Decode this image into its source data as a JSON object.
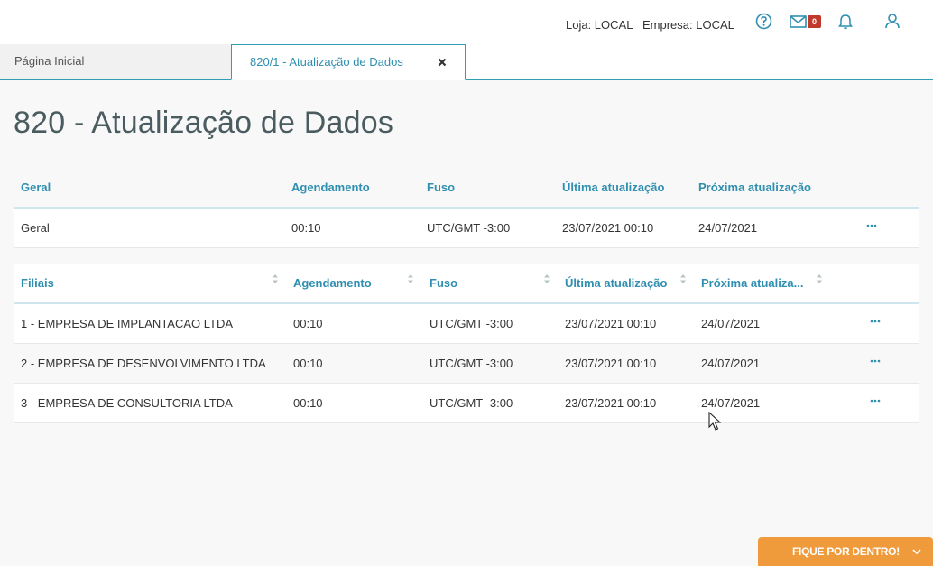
{
  "header": {
    "store": "Loja: LOCAL",
    "company": "Empresa: LOCAL",
    "mail_count": "0"
  },
  "tabs": {
    "home": "Página Inicial",
    "active": "820/1 - Atualização de Dados"
  },
  "page": {
    "title": "820 - Atualização de Dados"
  },
  "general_table": {
    "headers": [
      "Geral",
      "Agendamento",
      "Fuso",
      "Última atualização",
      "Próxima atualização"
    ],
    "row": [
      "Geral",
      "00:10",
      "UTC/GMT -3:00",
      "23/07/2021 00:10",
      "24/07/2021"
    ]
  },
  "branches_table": {
    "headers": [
      "Filiais",
      "Agendamento",
      "Fuso",
      "Última atualização",
      "Próxima atualiza..."
    ],
    "rows": [
      [
        "1 - EMPRESA DE IMPLANTACAO LTDA",
        "00:10",
        "UTC/GMT -3:00",
        "23/07/2021 00:10",
        "24/07/2021"
      ],
      [
        "2 - EMPRESA DE DESENVOLVIMENTO LTDA",
        "00:10",
        "UTC/GMT -3:00",
        "23/07/2021 00:10",
        "24/07/2021"
      ],
      [
        "3 - EMPRESA DE CONSULTORIA LTDA",
        "00:10",
        "UTC/GMT -3:00",
        "23/07/2021 00:10",
        "24/07/2021"
      ]
    ]
  },
  "footer_button": {
    "label": "FIQUE POR DENTRO!"
  },
  "colors": {
    "accent": "#2f8fb0",
    "badge": "#c0392b",
    "fab": "#ef9a3b"
  },
  "icons": [
    "help-icon",
    "mail-icon",
    "bell-icon",
    "user-icon",
    "close-icon",
    "sort-icon",
    "more-icon",
    "chevron-down-icon"
  ]
}
